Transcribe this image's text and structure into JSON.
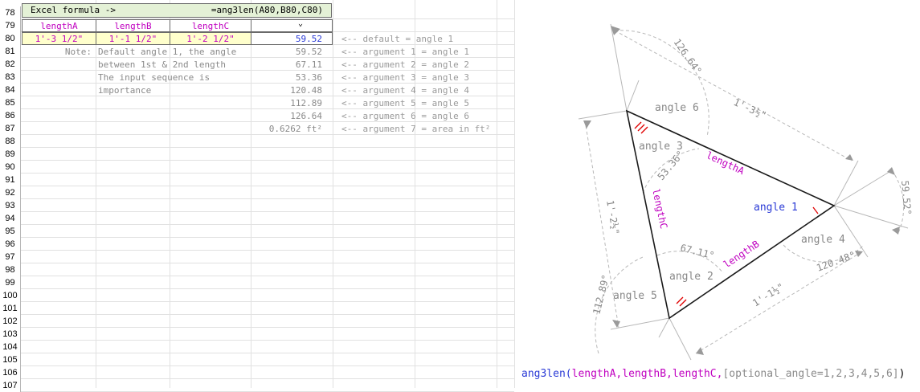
{
  "sheet": {
    "row_numbers": [
      "78",
      "79",
      "80",
      "81",
      "82",
      "83",
      "84",
      "85",
      "86",
      "87",
      "88",
      "89",
      "90",
      "91",
      "92",
      "93",
      "94",
      "95",
      "96",
      "97",
      "98",
      "99",
      "100",
      "101",
      "102",
      "103",
      "104",
      "105",
      "106",
      "107"
    ],
    "title_label": "Excel formula ->",
    "title_formula": "=ang3len(A80,B80,C80)",
    "headers": {
      "a": "lengthA",
      "b": "lengthB",
      "c": "lengthC"
    },
    "inputs": {
      "a": "1'-3 1/2\"",
      "b": "1'-1 1/2\"",
      "c": "1'-2 1/2\""
    },
    "result_default": "59.52",
    "note_label": "Note:",
    "note_lines": [
      "Default angle 1, the angle",
      "between 1st & 2nd length",
      "The input sequence is",
      "importance"
    ],
    "values": [
      "59.52",
      "67.11",
      "53.36",
      "120.48",
      "112.89",
      "126.64",
      "0.6262 ft²"
    ],
    "comments": [
      "<-- default = angle 1",
      "<-- argument 1 = angle 1",
      "<-- argument 2 = angle 2",
      "<-- argument 3 = angle 3",
      "<-- argument 4 = angle 4",
      "<-- argument 5 = angle 5",
      "<-- argument 6 = angle 6",
      "<-- argument 7 = area in ft²"
    ]
  },
  "diagram": {
    "angle_labels": {
      "a1": "angle 1",
      "a2": "angle 2",
      "a3": "angle 3",
      "a4": "angle 4",
      "a5": "angle 5",
      "a6": "angle 6"
    },
    "side_labels": {
      "a": "lengthA",
      "b": "lengthB",
      "c": "lengthC"
    },
    "dims": {
      "a": "1'-3½\"",
      "b": "1'-1½\"",
      "c": "1'-2½\""
    },
    "angle_values": {
      "a1": "59.52°",
      "a2": "67.11°",
      "a3": "53.36°",
      "a4": "120.48°",
      "a5": "112.89°",
      "a6": "126.64°"
    }
  },
  "formula": {
    "name": "ang3len(",
    "args": "lengthA,lengthB,lengthC,",
    "optional": "[optional_angle=1,2,3,4,5,6]",
    "close": ")"
  },
  "colors": {
    "magenta": "#c000c0",
    "blue": "#2b3bd6",
    "gray": "#8a8a8a",
    "green_fill": "#e4f1d6",
    "yellow_fill": "#ffffcc",
    "red": "#e00000"
  }
}
